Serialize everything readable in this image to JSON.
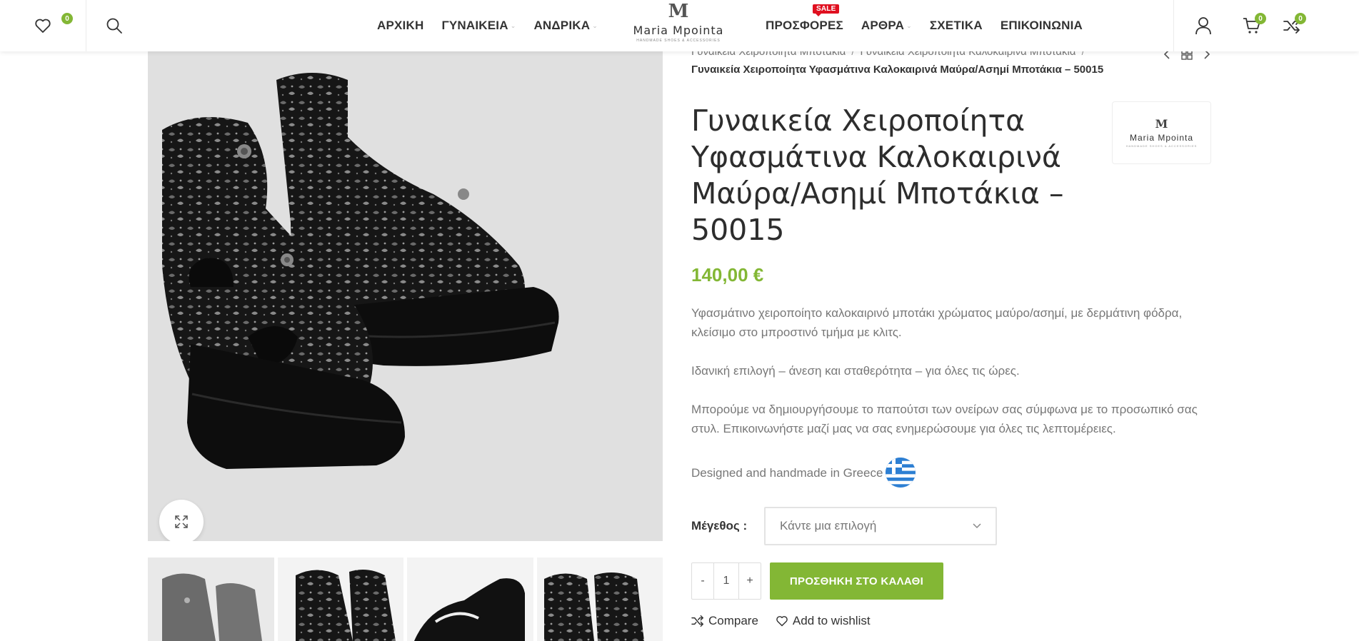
{
  "header": {
    "wishlist_count": "0",
    "cart_count": "0",
    "compare_count": "0",
    "nav_left": [
      {
        "label": "ΑΡΧΙΚΗ",
        "has_dropdown": false
      },
      {
        "label": "ΓΥΝΑΙΚΕΙΑ",
        "has_dropdown": true
      },
      {
        "label": "ΑΝΔΡΙΚΑ",
        "has_dropdown": true
      }
    ],
    "nav_right": [
      {
        "label": "ΠΡΟΣΦΟΡΕΣ",
        "has_dropdown": false,
        "tag": "SALE"
      },
      {
        "label": "ΑΡΘΡΑ",
        "has_dropdown": true
      },
      {
        "label": "ΣΧΕΤΙΚΑ",
        "has_dropdown": false
      },
      {
        "label": "ΕΠΙΚΟΙΝΩΝΙΑ",
        "has_dropdown": false
      }
    ],
    "logo": {
      "mark": "M",
      "name": "Maria Mpointa",
      "tagline": "HANDMADE SHOES & ACCESSORIES"
    }
  },
  "breadcrumbs": {
    "items": [
      "Γυναικεία Χειροποίητα Μποτάκια",
      "Γυναικεία Χειροποίητα Καλοκαιρινά Μποτάκια"
    ],
    "separator": "/",
    "current": "Γυναικεία Χειροποίητα Υφασμάτινα Καλοκαιρινά Μαύρα/Ασημί Μποτάκια – 50015"
  },
  "product": {
    "title": "Γυναικεία Χειροποίητα Υφασμάτινα Καλοκαιρινά Μαύρα/Ασημί Μποτάκια – 50015",
    "price": "140,00 €",
    "description": [
      "Υφασμάτινο χειροποίητο καλοκαιρινό μποτάκι χρώματος μαύρο/ασημί, με δερμάτινη φόδρα, κλείσιμο στο μπροστινό τμήμα με κλιτς.",
      "Ιδανική επιλογή – άνεση και σταθερότητα – για όλες τις ώρες.",
      "Μπορούμε να δημιουργήσουμε το παπούτσι των ονείρων σας σύμφωνα με το προσωπικό σας στυλ. Επικοινωνήστε μαζί μας να σας ενημερώσουμε για όλες τις λεπτομέρειες."
    ],
    "origin": "Designed and handmade in Greece",
    "size_label": "Μέγεθος",
    "size_placeholder": "Κάντε μια επιλογή",
    "quantity": "1",
    "qty_minus": "-",
    "qty_plus": "+",
    "add_to_cart": "ΠΡΟΣΘΗΚΗ ΣΤΟ ΚΑΛΑΘΙ",
    "compare": "Compare",
    "wishlist": "Add to wishlist",
    "brand": {
      "mark": "M",
      "name": "Maria Mpointa",
      "tagline": "HANDMADE SHOES & ACCESSORIES"
    }
  },
  "colors": {
    "accent": "#83b735",
    "sale": "#e01020",
    "text": "#333333",
    "muted": "#777777"
  },
  "gallery": {
    "thumbnail_count": 4,
    "active_thumbnail": 1
  }
}
